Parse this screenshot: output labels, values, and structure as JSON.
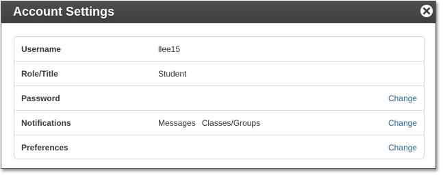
{
  "dialog": {
    "title": "Account Settings",
    "close_icon": "close-circle-icon"
  },
  "rows": [
    {
      "label": "Username",
      "value": "llee15"
    },
    {
      "label": "Role/Title",
      "value": "Student"
    },
    {
      "label": "Password",
      "action": "Change"
    },
    {
      "label": "Notifications",
      "values": [
        "Messages",
        "Classes/Groups"
      ],
      "action": "Change"
    },
    {
      "label": "Preferences",
      "action": "Change"
    }
  ],
  "colors": {
    "titlebar": "#444444",
    "link": "#2a6496"
  }
}
